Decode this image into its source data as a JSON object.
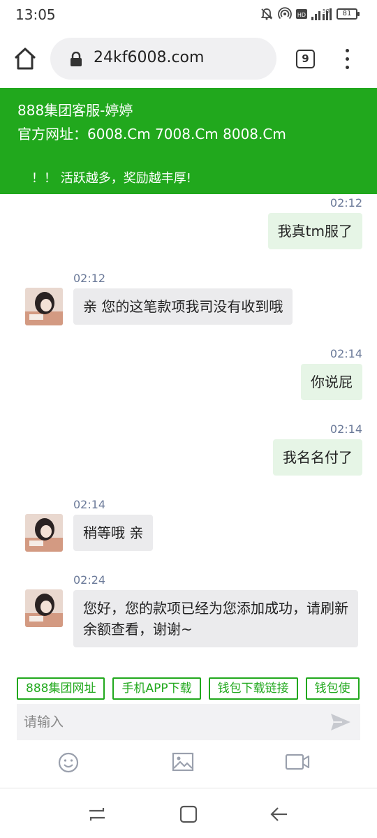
{
  "status_bar": {
    "time": "13:05",
    "battery": "81",
    "icons": [
      "mute-bell-icon",
      "hotspot-icon",
      "hd-icon",
      "signal-icon",
      "battery-icon"
    ]
  },
  "browser": {
    "url": "24kf6008.com",
    "tab_count": "9",
    "icons": [
      "home-icon",
      "lock-icon",
      "menu-dots-icon"
    ]
  },
  "header": {
    "name": "888集团客服-婷婷",
    "site": "官方网址：6008.Cm 7008.Cm 8008.Cm",
    "promo": "！！ 活跃越多，奖励越丰厚!",
    "color": "#21a81d"
  },
  "messages": [
    {
      "side": "out",
      "time": "02:12",
      "text": "我真tm服了"
    },
    {
      "side": "in",
      "time": "02:12",
      "text": "亲 您的这笔款项我司没有收到哦"
    },
    {
      "side": "out",
      "time": "02:14",
      "text": "你说屁"
    },
    {
      "side": "out",
      "time": "02:14",
      "text": "我名名付了"
    },
    {
      "side": "in",
      "time": "02:14",
      "text": "稍等哦 亲"
    },
    {
      "side": "in",
      "time": "02:24",
      "text": "您好，您的款项已经为您添加成功，请刷新余额查看，谢谢~"
    }
  ],
  "quick_links": [
    "888集团网址",
    "手机APP下载",
    "钱包下载链接",
    "钱包使"
  ],
  "input": {
    "placeholder": "请输入"
  },
  "toolbar": {
    "icons": [
      "emoji-icon",
      "image-icon",
      "video-icon"
    ]
  },
  "nav": {
    "icons": [
      "recents-icon",
      "home-square-icon",
      "back-icon"
    ]
  }
}
